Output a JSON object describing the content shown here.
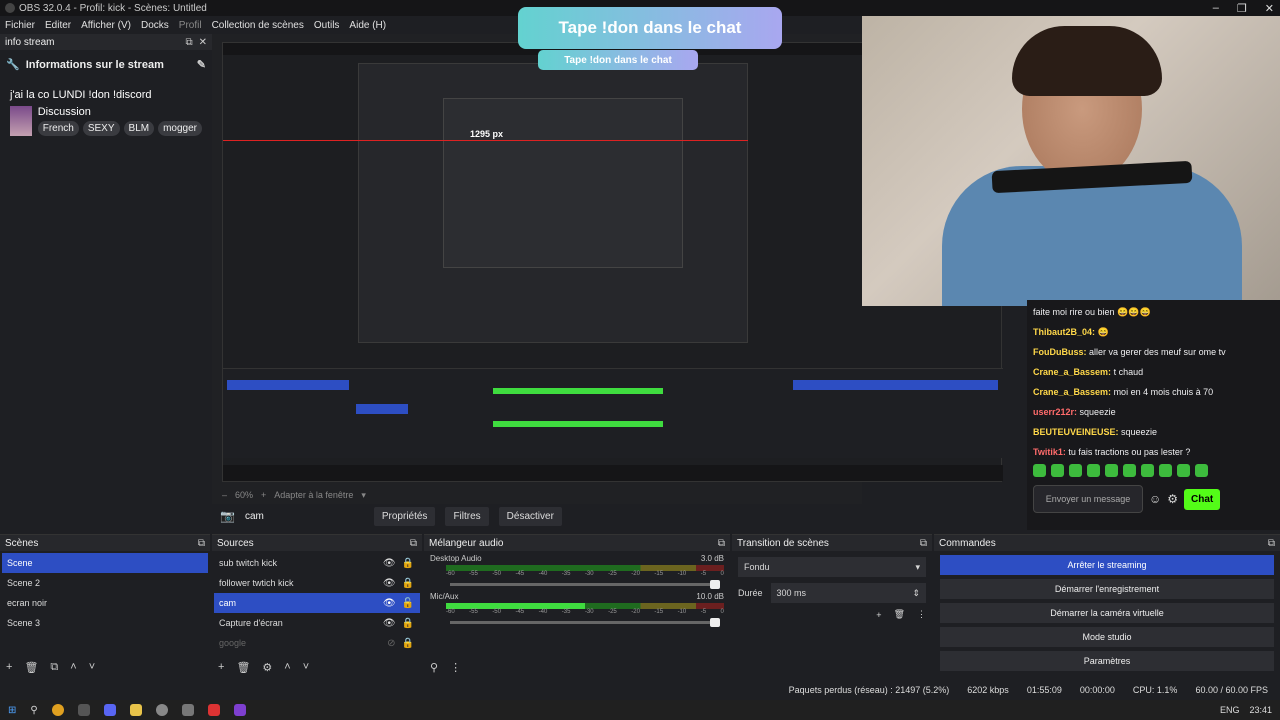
{
  "window": {
    "title": "OBS 32.0.4 - Profil: kick - Scènes: Untitled",
    "controls": [
      "–",
      "❐",
      "✕"
    ]
  },
  "menu": [
    "Fichier",
    "Editer",
    "Afficher (V)",
    "Docks",
    "Profil",
    "Collection de scènes",
    "Outils",
    "Aide (H)"
  ],
  "info_dock": {
    "header": "info stream",
    "title": "Informations sur le stream",
    "stream_title": "j'ai la co LUNDI !don !discord",
    "category": "Discussion",
    "tags": [
      "French",
      "SEXY",
      "BLM",
      "mogger"
    ]
  },
  "overlay": {
    "banner": "Tape !don dans le chat",
    "measure": "1295 px"
  },
  "chat": {
    "messages": [
      {
        "user": "",
        "text": "faite moi rire ou bien 😄😄😄",
        "color": "#efeff1"
      },
      {
        "user": "Thibaut2B_04:",
        "text": "😄",
        "color": "#ffd84a"
      },
      {
        "user": "FouDuBuss:",
        "text": "aller va gerer des meuf sur ome tv",
        "color": "#ffd84a"
      },
      {
        "user": "Crane_a_Bassem:",
        "text": "t chaud",
        "color": "#ffd84a"
      },
      {
        "user": "Crane_a_Bassem:",
        "text": "moi en 4 mois chuis à 70",
        "color": "#ffd84a"
      },
      {
        "user": "userr212r:",
        "text": "squeezie",
        "color": "#ff6b6b"
      },
      {
        "user": "BEUTEUVEINEUSE:",
        "text": "squeezie",
        "color": "#ffd84a"
      },
      {
        "user": "Twitik1:",
        "text": "tu fais tractions ou pas lester ?",
        "color": "#ff6b6b"
      }
    ],
    "input_placeholder": "Envoyer un message",
    "send_label": "Chat"
  },
  "preview_bar": {
    "zoom": "60%",
    "fit": "Adapter à la fenêtre",
    "source": "cam",
    "props": "Propriétés",
    "filters": "Filtres",
    "disable": "Désactiver"
  },
  "scenes": {
    "header": "Scènes",
    "items": [
      "Scene",
      "Scene 2",
      "ecran noir",
      "Scene 3"
    ]
  },
  "sources": {
    "header": "Sources",
    "items": [
      "sub twitch kick",
      "follower twtich kick",
      "cam",
      "Capture d'écran",
      "google"
    ]
  },
  "mixer": {
    "header": "Mélangeur audio",
    "channels": [
      {
        "name": "Desktop Audio",
        "db": "3.0 dB",
        "level": 0.0
      },
      {
        "name": "Mic/Aux",
        "db": "10.0 dB",
        "level": 0.5
      }
    ],
    "ticks": [
      "-60",
      "-55",
      "-50",
      "-45",
      "-40",
      "-35",
      "-30",
      "-25",
      "-20",
      "-15",
      "-10",
      "-5",
      "0"
    ]
  },
  "transitions": {
    "header": "Transition de scènes",
    "type": "Fondu",
    "duration_label": "Durée",
    "duration": "300 ms"
  },
  "commands": {
    "header": "Commandes",
    "buttons": [
      "Arrêter le streaming",
      "Démarrer l'enregistrement",
      "Démarrer la caméra virtuelle",
      "Mode studio",
      "Paramètres"
    ]
  },
  "status": {
    "dropped": "Paquets perdus (réseau) : 21497 (5.2%)",
    "bitrate": "6202 kbps",
    "stream_time": "01:55:09",
    "rec_time": "00:00:00",
    "cpu": "CPU: 1.1%",
    "fps": "60.00 / 60.00 FPS"
  },
  "tray": {
    "lang": "ENG",
    "clock": "23:41"
  }
}
